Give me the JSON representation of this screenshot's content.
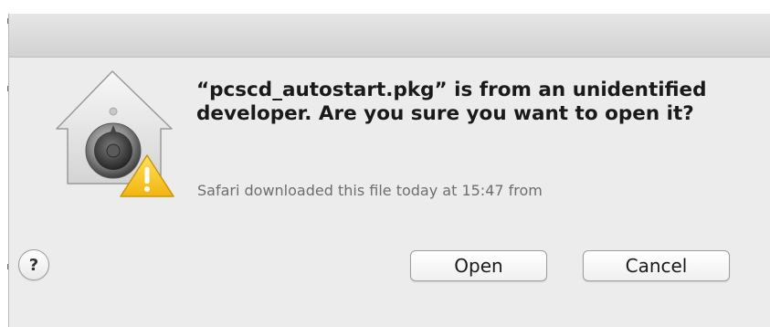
{
  "dialog": {
    "headline": "“pcscd_autostart.pkg” is from an unidentified developer. Are you sure you want to open it?",
    "info": "Safari downloaded this file today at 15:47 from",
    "help_label": "?",
    "open_label": "Open",
    "cancel_label": "Cancel",
    "icon": "gatekeeper-lock-house-warning-icon"
  },
  "colors": {
    "dialog_background": "#ececec",
    "warning_yellow": "#f6c62a",
    "info_text": "#6e6e6e"
  }
}
